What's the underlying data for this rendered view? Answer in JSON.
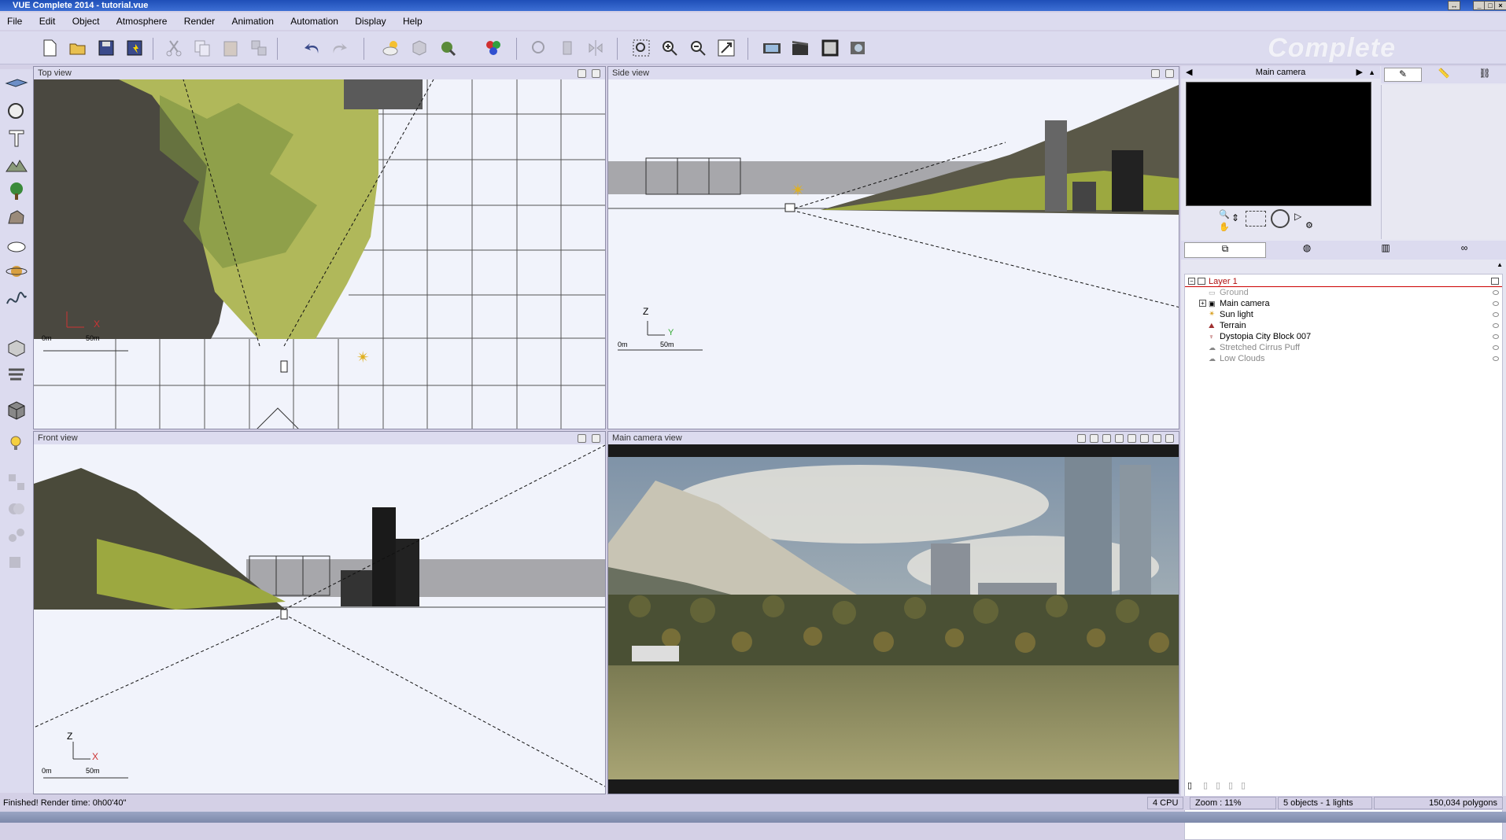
{
  "window": {
    "title": "VUE Complete 2014 - tutorial.vue"
  },
  "menu": [
    "File",
    "Edit",
    "Object",
    "Atmosphere",
    "Render",
    "Animation",
    "Automation",
    "Display",
    "Help"
  ],
  "brand": "Complete",
  "viewports": {
    "top": {
      "title": "Top view",
      "scale_start": "0m",
      "scale_end": "50m",
      "axis_v": "",
      "axis_h": "X"
    },
    "side": {
      "title": "Side view",
      "scale_start": "0m",
      "scale_end": "50m",
      "axis_v": "Z",
      "axis_h": "Y"
    },
    "front": {
      "title": "Front view",
      "scale_start": "0m",
      "scale_end": "50m",
      "axis_v": "Z",
      "axis_h": "X"
    },
    "camera": {
      "title": "Main camera view"
    }
  },
  "preview": {
    "camera_name": "Main camera"
  },
  "layers": {
    "layer_name": "Layer 1",
    "items": [
      {
        "label": "Ground",
        "dim": true
      },
      {
        "label": "Main camera",
        "dim": false
      },
      {
        "label": "Sun light",
        "dim": false
      },
      {
        "label": "Terrain",
        "dim": false
      },
      {
        "label": "Dystopia City Block 007",
        "dim": false
      },
      {
        "label": "Stretched Cirrus Puff",
        "dim": true
      },
      {
        "label": "Low Clouds",
        "dim": true
      }
    ]
  },
  "status": {
    "message": "Finished! Render time: 0h00'40\"",
    "cpu": "4 CPU",
    "zoom": "Zoom : 11%",
    "objects": "5 objects - 1 lights",
    "polygons": "150,034 polygons"
  },
  "colors": {
    "accent": "#1f4fb8",
    "viewport_bg": "#f1f3fb",
    "layer_red": "#b01010"
  }
}
